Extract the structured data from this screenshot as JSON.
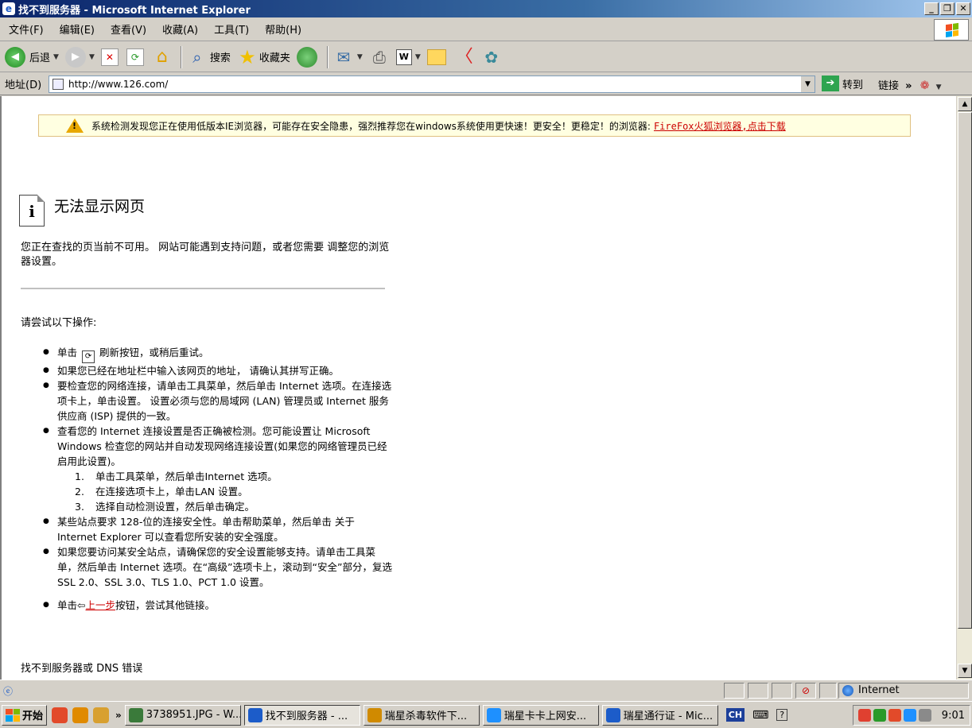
{
  "window": {
    "title": "找不到服务器 - Microsoft Internet Explorer"
  },
  "menu": [
    "文件(F)",
    "编辑(E)",
    "查看(V)",
    "收藏(A)",
    "工具(T)",
    "帮助(H)"
  ],
  "toolbar": {
    "back": "后退",
    "search": "搜索",
    "favorites": "收藏夹"
  },
  "address": {
    "label": "地址(D)",
    "url": "http://www.126.com/",
    "go": "转到",
    "links": "链接"
  },
  "infobar": {
    "text": "系统检测发现您正在使用低版本IE浏览器，可能存在安全隐患，强烈推荐您在windows系统使用更快速！更安全！更稳定！的浏览器:",
    "link": "FireFox火狐浏览器,点击下载"
  },
  "error": {
    "title": "无法显示网页",
    "description": "您正在查找的页当前不可用。 网站可能遇到支持问题，或者您需要 调整您的浏览器设置。",
    "try_heading": "请尝试以下操作:",
    "tips": [
      {
        "a": "单击",
        "b": "刷新按钮，或稍后重试。"
      },
      {
        "text": "如果您已经在地址栏中输入该网页的地址， 请确认其拼写正确。"
      },
      {
        "text": "要检查您的网络连接，请单击工具菜单，然后单击 Internet 选项。在连接选项卡上，单击设置。 设置必须与您的局域网 (LAN) 管理员或 Internet 服务供应商 (ISP) 提供的一致。"
      },
      {
        "text": "查看您的 Internet 连接设置是否正确被检测。您可能设置让 Microsoft Windows 检查您的网站并自动发现网络连接设置(如果您的网络管理员已经启用此设置)。"
      },
      {
        "n": "1.",
        "text": "单击工具菜单，然后单击Internet 选项。"
      },
      {
        "n": "2.",
        "text": "在连接选项卡上，单击LAN 设置。"
      },
      {
        "n": "3.",
        "text": "选择自动检测设置，然后单击确定。"
      },
      {
        "text": "某些站点要求 128-位的连接安全性。单击帮助菜单，然后单击 关于 Internet Explorer 可以查看您所安装的安全强度。"
      },
      {
        "text": "如果您要访问某安全站点，请确保您的安全设置能够支持。请单击工具菜单，然后单击 Internet 选项。在“高级”选项卡上，滚动到“安全”部分，复选 SSL 2.0、SSL 3.0、TLS 1.0、PCT 1.0 设置。"
      },
      {
        "a": "单击",
        "link": "上一步",
        "b": "按钮，尝试其他链接。"
      }
    ],
    "footer": "找不到服务器或 DNS 错误"
  },
  "status": {
    "zone": "Internet"
  },
  "taskbar": {
    "start": "开始",
    "more": "»",
    "tasks": [
      {
        "label": "3738951.JPG - W...",
        "color": "#3a7a3a"
      },
      {
        "label": "找不到服务器 - ...",
        "color": "#1c5cc9",
        "active": true
      },
      {
        "label": "瑞星杀毒软件下...",
        "color": "#d08a00"
      },
      {
        "label": "瑞星卡卡上网安...",
        "color": "#1e90ff"
      },
      {
        "label": "瑞星通行证 - Mic...",
        "color": "#1c5cc9"
      }
    ],
    "lang": "CH",
    "clock": "9:01"
  }
}
